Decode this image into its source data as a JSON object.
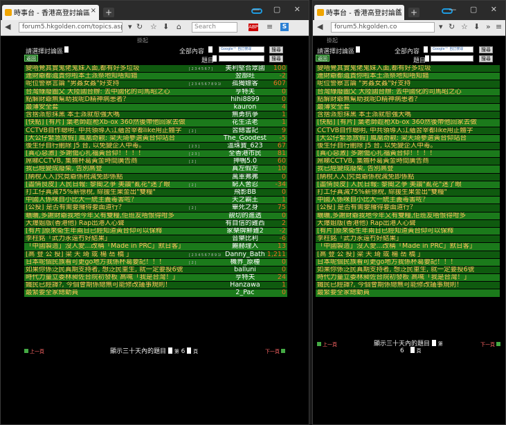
{
  "colors": {
    "row_a": "#0f5a0f",
    "row_b": "#1b7a1b",
    "title": "#ffc55a",
    "author": "#ffffff",
    "replies": "#e87222"
  },
  "browser": {
    "tab_title": "時事台 - 香港高登討論區",
    "url_left": "forum5.hkgolden.com/topics.aspx?type=",
    "url_right": "forum5.hkgolden.co",
    "search_placeholder": "Search",
    "abp": "ABP",
    "s_icon": "S",
    "close": "×",
    "new_tab": "+",
    "window_controls": "— ▢ ✕"
  },
  "forum": {
    "top_mini": "掛起",
    "select_label": "請選擇討論區",
    "back_button": "返回",
    "all_content": "全部內容",
    "google_label": "Google™ 自訂搜尋",
    "search_button": "搜尋",
    "subject_label": "題目",
    "footer_text": "顯示三十天內的題目",
    "page_prefix": "第",
    "page_number": "6",
    "page_suffix": "頁",
    "prev_page": "上一頁",
    "next_page": "下一頁"
  },
  "topics": [
    {
      "title": "變唔覺其實鬼佬鬼妹入面,都有好多垃圾",
      "pages": "[ 2 3 4 5 6 7 ]",
      "author": "美利堅合眾國",
      "replies": "100"
    },
    {
      "title": "連財爺都遺責你啦本土派祭地知唔知錯",
      "pages": "",
      "author": "翌部旺",
      "replies": "-2"
    },
    {
      "title": "呢位警察言論 \"男姦女姦\"好支持",
      "pages": "[ 2 3 4 5 6 7 8 9 10 31 32 33 34 35 36 ]",
      "author": "孤獨嫖客",
      "replies": "607"
    },
    {
      "title": "台灣綠廢圖父 大陸國台辦: 去中國化的司馬昭之心",
      "pages": "",
      "author": "亨特夫",
      "replies": "0"
    },
    {
      "title": "點解財爺無幫助我呢D精神病患者？",
      "pages": "",
      "author": "hihi8899",
      "replies": "0"
    },
    {
      "title": "最薄安全套",
      "pages": "",
      "author": "kauron",
      "replies": "4"
    },
    {
      "title": "含捨派愈抹黑 本土派就愈強大嗎",
      "pages": "",
      "author": "無勇抗爭",
      "replies": "1"
    },
    {
      "title": "[快點] [有片] 葉老師趁枪Xb-ox 360然後帶他回家去做",
      "pages": "",
      "author": "花生法老",
      "replies": "1"
    },
    {
      "title": "CCTVB自作聰明, 中共領導人江蘊習宰都like用正體字",
      "pages": "[ 2 ]",
      "author": "習總書記",
      "replies": "9"
    },
    {
      "title": "[大公仔緊急放假] 鳳凰奇觀: 梁天琦參選黃台仰站台",
      "pages": "",
      "author": "The_Goodest",
      "replies": "-5"
    },
    {
      "title": "後生仔自行刪除 J5 台, 以免變企人中毒。",
      "pages": "[ 2 3 ]",
      "author": "溫珠寶_623",
      "replies": "67"
    },
    {
      "title": "[真心惡激] 多謝傷心扎福黃台仰！！！！",
      "pages": "[ 2 3 ]",
      "author": "全香港市民",
      "replies": "81"
    },
    {
      "title": "屌睇CCTVB, 集體杯葛黃金時間廣告商",
      "pages": "[ 2 ]",
      "author": "抻鴨5.0",
      "replies": "60"
    },
    {
      "title": "我已經變成廢柴, 告別高登",
      "pages": "",
      "author": "真左假左",
      "replies": "10"
    },
    {
      "title": "[納稅人入]究竟爺係稅減免即係點",
      "pages": "",
      "author": "萬軍弗弗",
      "replies": "0"
    },
    {
      "title": "[盡情良皮] 人民日報: 黎閩之爭 美讚\"亂花\"迷了眼",
      "pages": "[ 2 ]",
      "author": "窮人舍忍",
      "replies": "-34"
    },
    {
      "title": "打工仔真減75%薪徐稅, 綜援生果金出\"雙糧\"",
      "pages": "",
      "author": "飛影BB",
      "replies": "0"
    },
    {
      "title": "中國人係咪自小比大一統主義毒害咗？",
      "pages": "",
      "author": "天之霸王",
      "replies": "1"
    },
    {
      "title": "[公投] 是否有需要攞得要面道行？",
      "pages": "[ 2 ]",
      "author": "畢死之身",
      "replies": "75"
    },
    {
      "title": "曠曠,多謝財爺我地今年又有雙糧,佢班友唔恨得咁多",
      "pages": "",
      "author": "靚切的進透",
      "replies": "0"
    },
    {
      "title": "大爆姐版(香港他) Rap出港人心聲",
      "pages": "",
      "author": "有自信的雞西",
      "replies": "2"
    },
    {
      "title": "[有片]原來衞生年兩日已經知道黃台仰可以保釋",
      "pages": "",
      "author": "家樂牌鮮雞2",
      "replies": "-2"
    },
    {
      "title": "李柱銘「武力永遠冇好結果」",
      "pages": "",
      "author": "音樂比利",
      "replies": "-6"
    },
    {
      "title": "「中國製造」沒人愛...改稱「Made in PRC」默日客」",
      "pages": "",
      "author": "麗赫理入",
      "replies": "13"
    },
    {
      "title": "[高 登 公 投] 梁 天 琦 或 楊 岳 橋 」",
      "pages": "[ 2 3 4 5 6 7 8 9 10 11 12 13 14 15 16 ]",
      "author": "Danny_Bath",
      "replies": "1,211"
    },
    {
      "title": "日本呢個民族看可更go地方我係杯葛要記！！！",
      "pages": "[ 2 ]",
      "author": "機界_原種",
      "replies": "0"
    },
    {
      "title": "如果你係泛民真期支持者, 想泛民重生, 就一定要投6號",
      "pages": "",
      "author": "balluni",
      "replies": "0"
    },
    {
      "title": "時代力量立委林昶佐台院初發板 高喊「我是台灣！」",
      "pages": "",
      "author": "亨特夫",
      "replies": "24"
    },
    {
      "title": "鐵民已經譯?, 今個會期係總無可能修改議事規則！",
      "pages": "",
      "author": "Hanzawa",
      "replies": "1"
    },
    {
      "title": "最緊要全家總動員",
      "pages": "",
      "author": "2_Pac",
      "replies": "0"
    }
  ]
}
